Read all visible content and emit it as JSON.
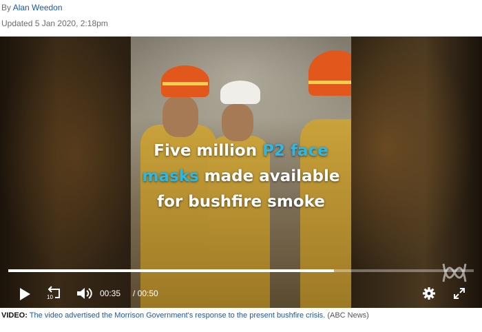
{
  "byline": {
    "prefix": "By",
    "author": "Alan Weedon"
  },
  "updated": "Updated 5 Jan 2020, 2:18pm",
  "video": {
    "caption": {
      "line1_a": "Five million",
      "line1_b": "P2 face",
      "line2_a": "masks",
      "line2_b": "made available",
      "line3": "for bushfire smoke"
    },
    "current_time": "00:35",
    "duration": "/ 00:50",
    "progress_fraction": 0.7,
    "replay_label": "10",
    "accent_color": "#2bb8e6",
    "icons": [
      "play-icon",
      "replay-10-icon",
      "volume-icon",
      "settings-gear-icon",
      "fullscreen-icon",
      "abc-logo"
    ]
  },
  "footer": {
    "label": "VIDEO:",
    "text": "The video advertised the Morrison Government's response to the present bushfire crisis.",
    "source": "(ABC News)"
  }
}
